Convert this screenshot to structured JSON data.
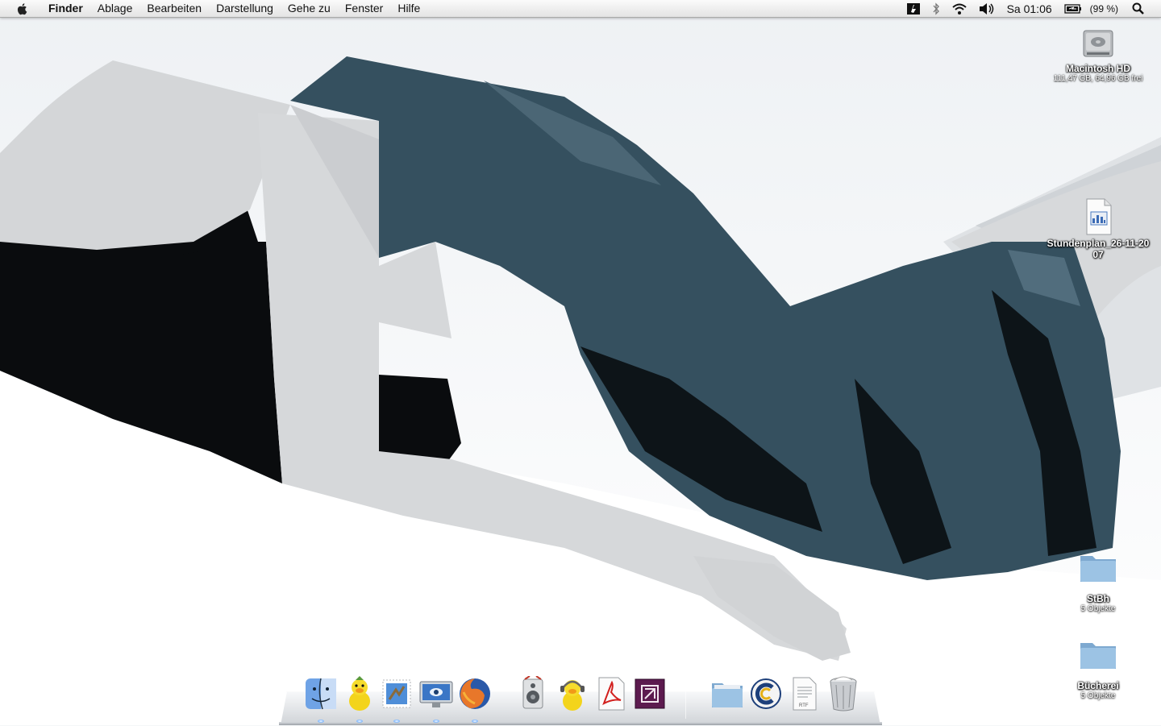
{
  "menubar": {
    "apple_icon": "apple-logo-icon",
    "items": [
      {
        "label": "Finder",
        "name": "menu-finder"
      },
      {
        "label": "Ablage",
        "name": "menu-ablage"
      },
      {
        "label": "Bearbeiten",
        "name": "menu-bearbeiten"
      },
      {
        "label": "Darstellung",
        "name": "menu-darstellung"
      },
      {
        "label": "Gehe zu",
        "name": "menu-gehe-zu"
      },
      {
        "label": "Fenster",
        "name": "menu-fenster"
      },
      {
        "label": "Hilfe",
        "name": "menu-hilfe"
      }
    ],
    "status": {
      "icons": [
        "script-menu-icon",
        "bluetooth-icon",
        "wifi-icon",
        "volume-icon"
      ],
      "clock": "Sa 01:06",
      "battery_icon": "battery-icon",
      "battery_text": "(99 %)",
      "spotlight_icon": "spotlight-search-icon"
    }
  },
  "desktop": {
    "drive": {
      "label": "Macintosh HD",
      "sub": "111,47 GB, 64,96 GB frei",
      "icon": "hard-drive-icon"
    },
    "file": {
      "label": "Stundenplan_26-11-2007",
      "icon": "spreadsheet-document-icon"
    },
    "folders": [
      {
        "label": "StBh",
        "sub": "5 Objekte",
        "icon": "folder-icon"
      },
      {
        "label": "Bücherei",
        "sub": "5 Objekte",
        "icon": "folder-icon"
      }
    ]
  },
  "dock": {
    "items": [
      {
        "name": "finder",
        "icon": "finder-icon",
        "running": true
      },
      {
        "name": "adium",
        "icon": "adium-duck-icon",
        "running": true
      },
      {
        "name": "mail",
        "icon": "mail-stamp-icon",
        "running": true
      },
      {
        "name": "system-preferences",
        "icon": "display-icon",
        "running": true
      },
      {
        "name": "firefox",
        "icon": "firefox-icon",
        "running": true
      },
      {
        "name": "itunes",
        "icon": "speaker-icon",
        "running": false
      },
      {
        "name": "adium-2",
        "icon": "duck-headphones-icon",
        "running": false
      },
      {
        "name": "acrobat",
        "icon": "acrobat-icon",
        "running": false
      },
      {
        "name": "flash-app",
        "icon": "purple-app-icon",
        "running": false
      },
      {
        "name": "documents-stack",
        "icon": "folder-stack-icon",
        "running": false
      },
      {
        "name": "calendar-app",
        "icon": "c-logo-icon",
        "running": false
      },
      {
        "name": "rtf-document",
        "icon": "rtf-document-icon",
        "running": false
      },
      {
        "name": "trash",
        "icon": "trash-icon",
        "running": false
      }
    ]
  },
  "colors": {
    "dress": "#35505f",
    "hair": "#0a0c0e",
    "skin": "#d3d5d7",
    "background": "#f4f6f8",
    "folder": "#8fb8dc"
  }
}
